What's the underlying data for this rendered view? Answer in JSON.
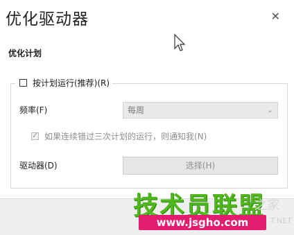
{
  "window": {
    "title": "优化驱动器",
    "close_glyph": "✕"
  },
  "section_title": "优化计划",
  "schedule_checkbox": {
    "label": "按计划运行(推荐)(R)",
    "checked": false
  },
  "frequency": {
    "label": "频率(F)",
    "value": "每周",
    "chevron": "⌄"
  },
  "notify_checkbox": {
    "label": "如果连续错过三次计划的运行，则通知我(N)",
    "checked": true
  },
  "drives": {
    "label": "驱动器(D)",
    "button_label": "选择(H)"
  },
  "watermark": {
    "text": "技术员联盟",
    "url": "www.jsgho.com",
    "ghost_text": "之家",
    "ghost_small": "T.NET"
  },
  "colors": {
    "watermark_green": "#4fb81d",
    "watermark_pink": "#e21c6f",
    "disabled_text": "#8f8f8f"
  }
}
